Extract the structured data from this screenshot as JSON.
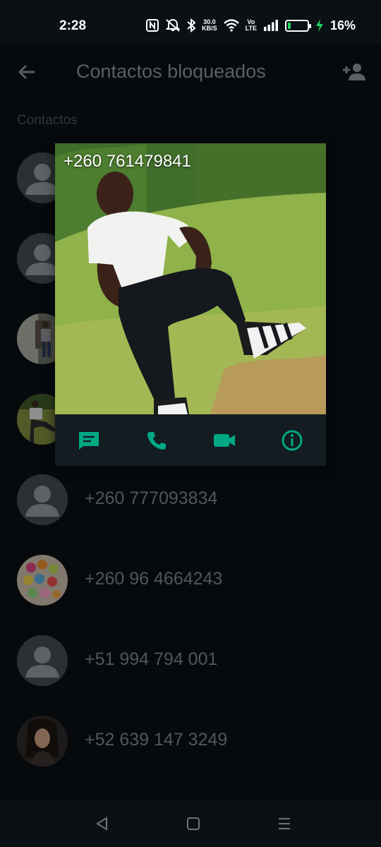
{
  "status_bar": {
    "time": "2:28",
    "net_speed_value": "30.0",
    "net_speed_unit": "KB/S",
    "volte_top": "Vo",
    "volte_bottom": "LTE",
    "battery_percent": "16%",
    "battery_level": 0.16,
    "icons": [
      "nfc-icon",
      "mute-icon",
      "bluetooth-icon",
      "wifi-icon",
      "signal-icon",
      "battery-icon",
      "charging-icon"
    ]
  },
  "app_bar": {
    "title": "Contactos bloqueados",
    "back_icon": "arrow-back-icon",
    "add_icon": "add-contact-icon"
  },
  "section_label": "Contactos",
  "contacts": [
    {
      "name": "",
      "avatar": "default"
    },
    {
      "name": "",
      "avatar": "default"
    },
    {
      "name": "",
      "avatar": "photo"
    },
    {
      "name": "",
      "avatar": "photo"
    },
    {
      "name": "+260 777093834",
      "avatar": "default"
    },
    {
      "name": "+260 96 4664243",
      "avatar": "photo"
    },
    {
      "name": "+51 994 794 001",
      "avatar": "default"
    },
    {
      "name": "+52 639 147 3249",
      "avatar": "photo"
    }
  ],
  "popup": {
    "name": "+260 761479841",
    "actions": [
      "message-icon",
      "call-icon",
      "video-call-icon",
      "info-icon"
    ]
  },
  "colors": {
    "background": "#0b1014",
    "accent": "#00a884",
    "text_muted": "#7c8488"
  },
  "nav_bar": {
    "icons": [
      "nav-back-icon",
      "nav-home-icon",
      "nav-menu-icon"
    ]
  }
}
